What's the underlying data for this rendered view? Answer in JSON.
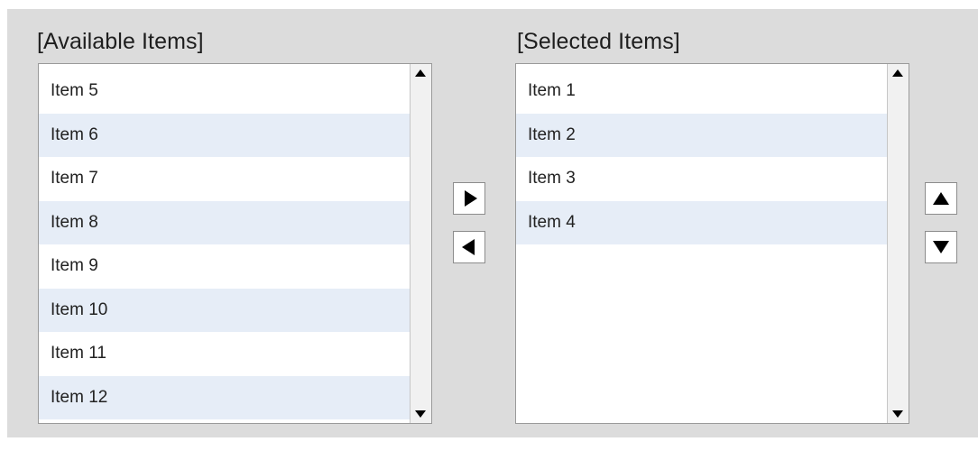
{
  "available": {
    "title": "[Available Items]",
    "items": [
      "Item 5",
      "Item 6",
      "Item 7",
      "Item 8",
      "Item 9",
      "Item 10",
      "Item 11",
      "Item 12"
    ]
  },
  "selected": {
    "title": "[Selected Items]",
    "items": [
      "Item 1",
      "Item 2",
      "Item 3",
      "Item 4"
    ]
  },
  "controls": {
    "add": "arrow-right-icon",
    "remove": "arrow-left-icon",
    "move_up": "arrow-up-icon",
    "move_down": "arrow-down-icon"
  },
  "colors": {
    "panel": "#dcdcdc",
    "row_alt": "#e6edf7",
    "row": "#ffffff"
  }
}
